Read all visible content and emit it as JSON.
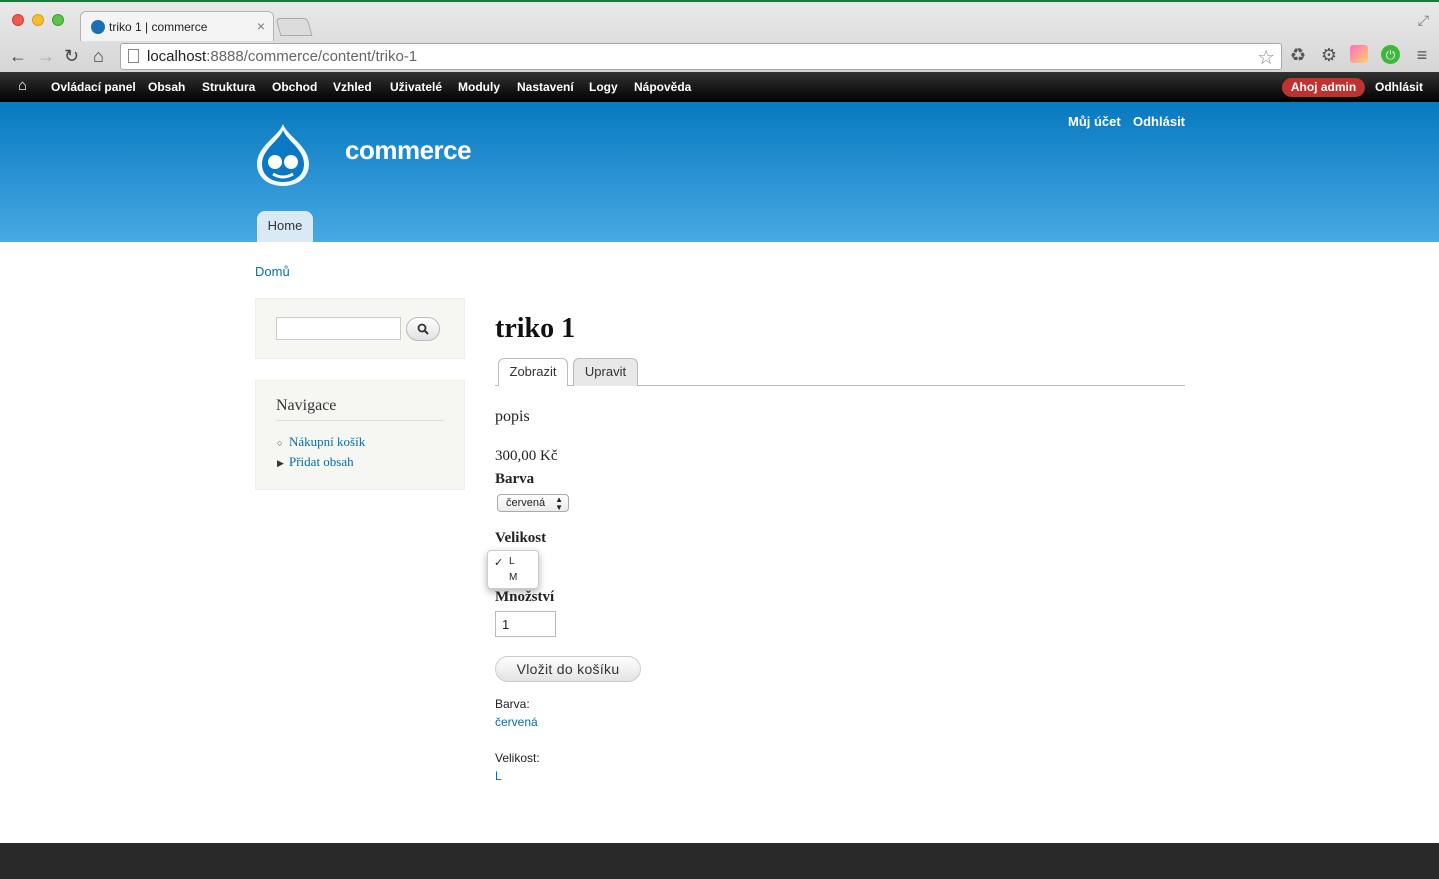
{
  "browser": {
    "tab_title": "triko 1 | commerce",
    "tab_close": "×",
    "url_host": "localhost",
    "url_path": ":8888/commerce/content/triko-1"
  },
  "toolbar": {
    "items": [
      "Ovládací panel",
      "Obsah",
      "Struktura",
      "Obchod",
      "Vzhled",
      "Uživatelé",
      "Moduly",
      "Nastavení",
      "Logy",
      "Nápověda"
    ],
    "hello": "Ahoj admin",
    "logout": "Odhlásit"
  },
  "header": {
    "site_name": "commerce",
    "my_account": "Můj účet",
    "logout": "Odhlásit",
    "home_tab": "Home"
  },
  "breadcrumb": "Domů",
  "sidebar": {
    "nav_title": "Navigace",
    "items": [
      "Nákupní košík",
      "Přidat obsah"
    ]
  },
  "product": {
    "title": "triko 1",
    "tabs": [
      "Zobrazit",
      "Upravit"
    ],
    "description": "popis",
    "price": "300,00 Kč",
    "color_label": "Barva",
    "color_selected": "červená",
    "size_label": "Velikost",
    "size_options": [
      "L",
      "M"
    ],
    "quantity_label": "Množství",
    "quantity_value": "1",
    "add_to_cart": "Vložit do košíku",
    "attr_color_label": "Barva:",
    "attr_color_value": "červená",
    "attr_size_label": "Velikost:",
    "attr_size_value": "L"
  },
  "colors": {
    "header_top": "#0779bf",
    "header_bottom": "#48a9e4",
    "link": "#0071b3",
    "hello_badge": "#c0322f"
  }
}
